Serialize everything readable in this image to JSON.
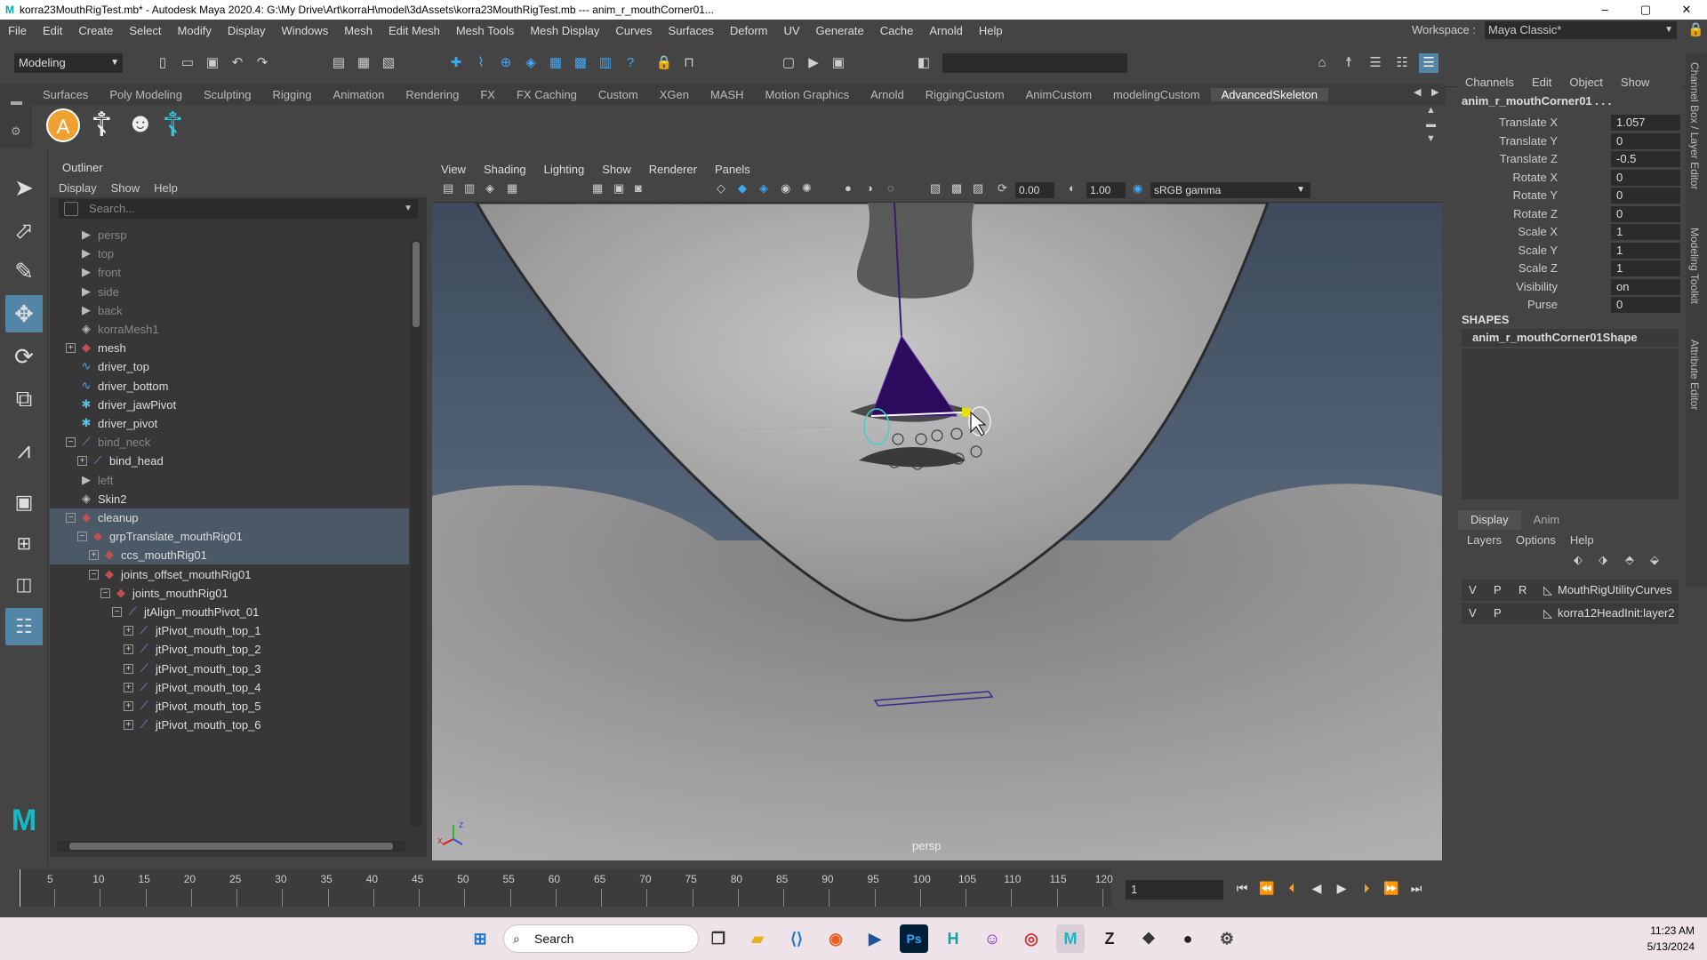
{
  "window": {
    "title": "korra23MouthRigTest.mb* - Autodesk Maya 2020.4: G:\\My Drive\\Art\\korraH\\model\\3dAssets\\korra23MouthRigTest.mb   ---   anim_r_mouthCorner01...",
    "minimize": "–",
    "maximize": "▢",
    "close": "✕"
  },
  "menubar": {
    "items": [
      "File",
      "Edit",
      "Create",
      "Select",
      "Modify",
      "Display",
      "Windows",
      "Mesh",
      "Edit Mesh",
      "Mesh Tools",
      "Mesh Display",
      "Curves",
      "Surfaces",
      "Deform",
      "UV",
      "Generate",
      "Cache",
      "Arnold",
      "Help"
    ],
    "workspace_label": "Workspace :",
    "workspace_value": "Maya Classic*"
  },
  "statusline": {
    "mode": "Modeling"
  },
  "shelf": {
    "tabs": [
      "Surfaces",
      "Poly Modeling",
      "Sculpting",
      "Rigging",
      "Animation",
      "Rendering",
      "FX",
      "FX Caching",
      "Custom",
      "XGen",
      "MASH",
      "Motion Graphics",
      "Arnold",
      "RiggingCustom",
      "AnimCustom",
      "modelingCustom",
      "AdvancedSkeleton"
    ],
    "active_tab": "AdvancedSkeleton",
    "icon_a": "A"
  },
  "outliner": {
    "title": "Outliner",
    "menu": [
      "Display",
      "Show",
      "Help"
    ],
    "search_placeholder": "Search...",
    "rows": [
      {
        "label": "persp",
        "icon": "camera-icon",
        "depth": 0,
        "dim": true
      },
      {
        "label": "top",
        "icon": "camera-icon",
        "depth": 0,
        "dim": true
      },
      {
        "label": "front",
        "icon": "camera-icon",
        "depth": 0,
        "dim": true
      },
      {
        "label": "side",
        "icon": "camera-icon",
        "depth": 0,
        "dim": true
      },
      {
        "label": "back",
        "icon": "camera-icon",
        "depth": 0,
        "dim": true
      },
      {
        "label": "korraMesh1",
        "icon": "mesh-icon",
        "depth": 0,
        "dim": true
      },
      {
        "label": "mesh",
        "icon": "group-icon",
        "depth": 0,
        "expander": "+"
      },
      {
        "label": "driver_top",
        "icon": "curve-icon",
        "depth": 0
      },
      {
        "label": "driver_bottom",
        "icon": "curve-icon",
        "depth": 0
      },
      {
        "label": "driver_jawPivot",
        "icon": "locator-icon",
        "depth": 0
      },
      {
        "label": "driver_pivot",
        "icon": "locator-icon",
        "depth": 0
      },
      {
        "label": "bind_neck",
        "icon": "joint-icon",
        "depth": 0,
        "dim": true,
        "expander": "−"
      },
      {
        "label": "bind_head",
        "icon": "joint-icon",
        "depth": 1,
        "expander": "+"
      },
      {
        "label": "left",
        "icon": "camera-icon",
        "depth": 0,
        "dim": true
      },
      {
        "label": "Skin2",
        "icon": "mesh-icon",
        "depth": 0
      },
      {
        "label": "cleanup",
        "icon": "group-icon",
        "depth": 0,
        "expander": "−",
        "highlight": true
      },
      {
        "label": "grpTranslate_mouthRig01",
        "icon": "group-icon",
        "depth": 1,
        "expander": "−",
        "highlight": true
      },
      {
        "label": "ccs_mouthRig01",
        "icon": "group-icon",
        "depth": 2,
        "expander": "+",
        "highlight": true
      },
      {
        "label": "joints_offset_mouthRig01",
        "icon": "group-icon",
        "depth": 2,
        "expander": "−"
      },
      {
        "label": "joints_mouthRig01",
        "icon": "group-icon",
        "depth": 3,
        "expander": "−"
      },
      {
        "label": "jtAlign_mouthPivot_01",
        "icon": "joint-icon",
        "depth": 4,
        "expander": "−"
      },
      {
        "label": "jtPivot_mouth_top_1",
        "icon": "joint-icon",
        "depth": 5,
        "expander": "+"
      },
      {
        "label": "jtPivot_mouth_top_2",
        "icon": "joint-icon",
        "depth": 5,
        "expander": "+"
      },
      {
        "label": "jtPivot_mouth_top_3",
        "icon": "joint-icon",
        "depth": 5,
        "expander": "+"
      },
      {
        "label": "jtPivot_mouth_top_4",
        "icon": "joint-icon",
        "depth": 5,
        "expander": "+"
      },
      {
        "label": "jtPivot_mouth_top_5",
        "icon": "joint-icon",
        "depth": 5,
        "expander": "+"
      },
      {
        "label": "jtPivot_mouth_top_6",
        "icon": "joint-icon",
        "depth": 5,
        "expander": "+"
      }
    ]
  },
  "viewport": {
    "menu": [
      "View",
      "Shading",
      "Lighting",
      "Show",
      "Renderer",
      "Panels"
    ],
    "exposure": "0.00",
    "gamma": "1.00",
    "colorspace": "sRGB gamma",
    "camera_label": "persp",
    "axis_x": "x",
    "axis_z": "z"
  },
  "channelbox": {
    "menu": [
      "Channels",
      "Edit",
      "Object",
      "Show"
    ],
    "object": "anim_r_mouthCorner01 . . .",
    "channels": [
      {
        "label": "Translate X",
        "value": "1.057"
      },
      {
        "label": "Translate Y",
        "value": "0"
      },
      {
        "label": "Translate Z",
        "value": "-0.5"
      },
      {
        "label": "Rotate X",
        "value": "0"
      },
      {
        "label": "Rotate Y",
        "value": "0"
      },
      {
        "label": "Rotate Z",
        "value": "0"
      },
      {
        "label": "Scale X",
        "value": "1"
      },
      {
        "label": "Scale Y",
        "value": "1"
      },
      {
        "label": "Scale Z",
        "value": "1"
      },
      {
        "label": "Visibility",
        "value": "on"
      },
      {
        "label": "Purse",
        "value": "0"
      }
    ],
    "shapes_heading": "SHAPES",
    "shape_name": "anim_r_mouthCorner01Shape"
  },
  "right_tabs": [
    "Channel Box / Layer Editor",
    "Modeling Toolkit",
    "Attribute Editor"
  ],
  "layers": {
    "tabs": [
      "Display",
      "Anim"
    ],
    "menu": [
      "Layers",
      "Options",
      "Help"
    ],
    "rows": [
      {
        "v": "V",
        "p": "P",
        "r": "R",
        "name": "MouthRigUtilityCurves"
      },
      {
        "v": "V",
        "p": "P",
        "r": "",
        "name": "korra12HeadInit:layer2"
      }
    ]
  },
  "timeline": {
    "ticks": [
      "5",
      "10",
      "15",
      "20",
      "25",
      "30",
      "35",
      "40",
      "45",
      "50",
      "55",
      "60",
      "65",
      "70",
      "75",
      "80",
      "85",
      "90",
      "95",
      "100",
      "105",
      "110",
      "115",
      "120"
    ],
    "start_label": "1",
    "current_frame": "1"
  },
  "taskbar": {
    "search_label": "Search",
    "time": "11:23 AM",
    "date": "5/13/2024"
  }
}
